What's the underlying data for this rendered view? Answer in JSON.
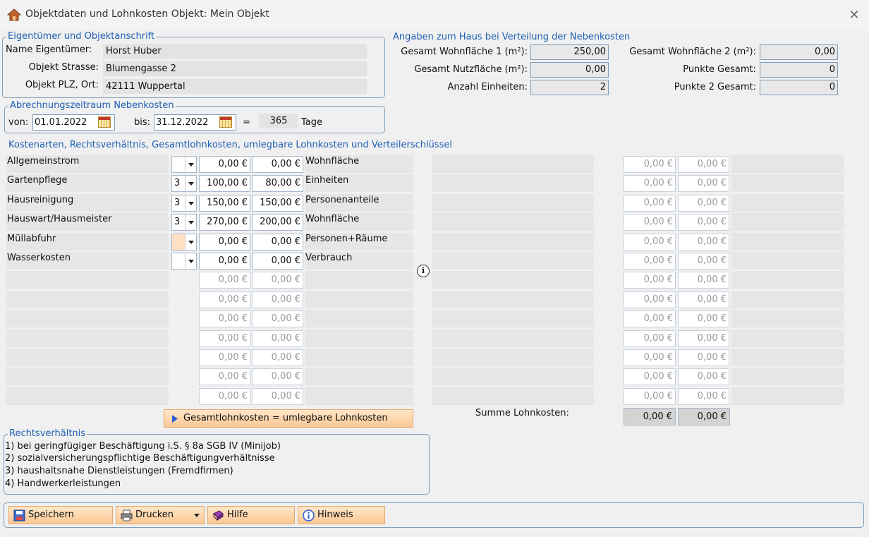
{
  "window": {
    "title": "Objektdaten und Lohnkosten Objekt: Mein Objekt",
    "close_glyph": "✕"
  },
  "owner": {
    "group_title": "Eigentümer und Objektanschrift",
    "name_label": "Name Eigentümer:",
    "name_value": "Horst Huber",
    "street_label": "Objekt Strasse:",
    "street_value": "Blumengasse 2",
    "city_label": "Objekt PLZ, Ort:",
    "city_value": "42111 Wuppertal"
  },
  "house": {
    "title": "Angaben zum Haus bei Verteilung der Nebenkosten",
    "wf1_label": "Gesamt Wohnfläche 1 (m²):",
    "wf1_value": "250,00",
    "wf2_label": "Gesamt Wohnfläche 2 (m²):",
    "wf2_value": "0,00",
    "nf_label": "Gesamt Nutzfläche (m²):",
    "nf_value": "0,00",
    "pg_label": "Punkte Gesamt:",
    "pg_value": "0",
    "units_label": "Anzahl Einheiten:",
    "units_value": "2",
    "pg2_label": "Punkte 2 Gesamt:",
    "pg2_value": "0"
  },
  "period": {
    "group_title": "Abrechnungszeitraum Nebenkosten",
    "from_label": "von:",
    "from_value": "01.01.2022",
    "to_label": "bis:",
    "to_value": "31.12.2022",
    "equals": "=",
    "days_value": "365",
    "days_label": "Tage"
  },
  "costs": {
    "title": "Kostenarten, Rechtsverhältnis, Gesamtlohnkosten, umlegbare Lohnkosten und Verteilerschlüssel",
    "rows": [
      {
        "name": "Allgemeinstrom",
        "rv": "",
        "gesamt": "0,00 €",
        "umlegbar": "0,00 €",
        "key": "Wohnfläche",
        "r_gesamt": "0,00 €",
        "r_umlegbar": "0,00 €"
      },
      {
        "name": "Gartenpflege",
        "rv": "3",
        "gesamt": "100,00 €",
        "umlegbar": "80,00 €",
        "key": "Einheiten",
        "r_gesamt": "0,00 €",
        "r_umlegbar": "0,00 €"
      },
      {
        "name": "Hausreinigung",
        "rv": "3",
        "gesamt": "150,00 €",
        "umlegbar": "150,00 €",
        "key": "Personenanteile",
        "r_gesamt": "0,00 €",
        "r_umlegbar": "0,00 €"
      },
      {
        "name": "Hauswart/Hausmeister",
        "rv": "3",
        "gesamt": "270,00 €",
        "umlegbar": "200,00 €",
        "key": "Wohnfläche",
        "r_gesamt": "0,00 €",
        "r_umlegbar": "0,00 €"
      },
      {
        "name": "Müllabfuhr",
        "rv": "",
        "gesamt": "0,00 €",
        "umlegbar": "0,00 €",
        "key": "Personen+Räume",
        "r_gesamt": "0,00 €",
        "r_umlegbar": "0,00 €"
      },
      {
        "name": "Wasserkosten",
        "rv": "",
        "gesamt": "0,00 €",
        "umlegbar": "0,00 €",
        "key": "Verbrauch",
        "r_gesamt": "0,00 €",
        "r_umlegbar": "0,00 €"
      },
      {
        "name": "",
        "rv": null,
        "gesamt": "0,00 €",
        "umlegbar": "0,00 €",
        "key": "",
        "r_gesamt": "0,00 €",
        "r_umlegbar": "0,00 €"
      },
      {
        "name": "",
        "rv": null,
        "gesamt": "0,00 €",
        "umlegbar": "0,00 €",
        "key": "",
        "r_gesamt": "0,00 €",
        "r_umlegbar": "0,00 €"
      },
      {
        "name": "",
        "rv": null,
        "gesamt": "0,00 €",
        "umlegbar": "0,00 €",
        "key": "",
        "r_gesamt": "0,00 €",
        "r_umlegbar": "0,00 €"
      },
      {
        "name": "",
        "rv": null,
        "gesamt": "0,00 €",
        "umlegbar": "0,00 €",
        "key": "",
        "r_gesamt": "0,00 €",
        "r_umlegbar": "0,00 €"
      },
      {
        "name": "",
        "rv": null,
        "gesamt": "0,00 €",
        "umlegbar": "0,00 €",
        "key": "",
        "r_gesamt": "0,00 €",
        "r_umlegbar": "0,00 €"
      },
      {
        "name": "",
        "rv": null,
        "gesamt": "0,00 €",
        "umlegbar": "0,00 €",
        "key": "",
        "r_gesamt": "0,00 €",
        "r_umlegbar": "0,00 €"
      },
      {
        "name": "",
        "rv": null,
        "gesamt": "0,00 €",
        "umlegbar": "0,00 €",
        "key": "",
        "r_gesamt": "0,00 €",
        "r_umlegbar": "0,00 €"
      }
    ],
    "copy_button": "Gesamtlohnkosten = umlegbare Lohnkosten",
    "sum_label": "Summe Lohnkosten:",
    "sum_gesamt": "0,00 €",
    "sum_umlegbar": "0,00 €",
    "info_glyph": "i"
  },
  "legal": {
    "group_title": "Rechtsverhältnis",
    "items": [
      "1) bei geringfügiger Beschäftigung i.S. § 8a SGB IV (Minijob)",
      "2) sozialversicherungspflichtige Beschäftigungverhältnisse",
      "3) haushaltsnahe Dienstleistungen (Fremdfirmen)",
      "4) Handwerkerleistungen"
    ]
  },
  "toolbar": {
    "save": "Speichern",
    "print": "Drucken",
    "help": "Hilfe",
    "note": "Hinweis"
  },
  "colors": {
    "accent": "#1d5fb4",
    "button_top": "#ffe7c9",
    "button_bottom": "#fbc894",
    "field_grey": "#e3e3e3"
  }
}
